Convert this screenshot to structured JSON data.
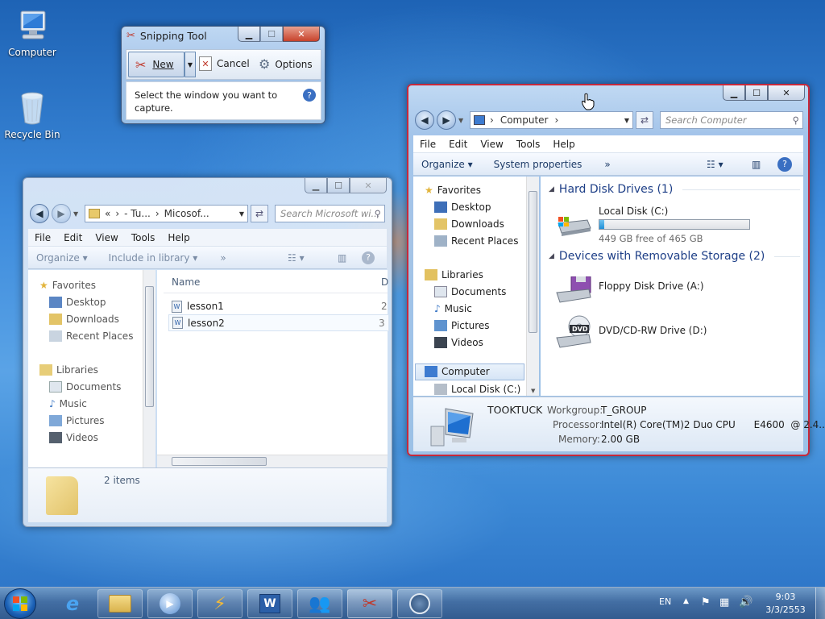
{
  "desktop": {
    "icons": [
      {
        "label": "Computer"
      },
      {
        "label": "Recycle Bin"
      }
    ]
  },
  "snipping": {
    "title": "Snipping Tool",
    "new_label": "New",
    "cancel_label": "Cancel",
    "options_label": "Options",
    "message": "Select the window you want to capture."
  },
  "explorer_back": {
    "address": {
      "prefix": "«",
      "crumb1": "- Tu...",
      "crumb2": "Micosof..."
    },
    "search_placeholder": "Search Microsoft wi...",
    "menu": [
      "File",
      "Edit",
      "View",
      "Tools",
      "Help"
    ],
    "commands": {
      "organize": "Organize",
      "include": "Include in library",
      "more": "»"
    },
    "nav": {
      "favorites": "Favorites",
      "favorites_items": [
        "Desktop",
        "Downloads",
        "Recent Places"
      ],
      "libraries": "Libraries",
      "library_items": [
        "Documents",
        "Music",
        "Pictures",
        "Videos"
      ]
    },
    "columns": {
      "name": "Name",
      "date": "D"
    },
    "files": [
      {
        "name": "lesson1",
        "tail": "2"
      },
      {
        "name": "lesson2",
        "tail": "3"
      }
    ],
    "status": "2 items"
  },
  "computer": {
    "address": {
      "crumb": "Computer"
    },
    "search_placeholder": "Search Computer",
    "menu": [
      "File",
      "Edit",
      "View",
      "Tools",
      "Help"
    ],
    "commands": {
      "organize": "Organize",
      "system": "System properties",
      "more": "»"
    },
    "nav": {
      "favorites": "Favorites",
      "favorites_items": [
        "Desktop",
        "Downloads",
        "Recent Places"
      ],
      "libraries": "Libraries",
      "library_items": [
        "Documents",
        "Music",
        "Pictures",
        "Videos"
      ],
      "computer": "Computer",
      "local_disk": "Local Disk (C:)"
    },
    "groups": {
      "hdd": "Hard Disk Drives (1)",
      "removable": "Devices with Removable Storage (2)"
    },
    "drives": {
      "c_label": "Local Disk (C:)",
      "c_free": "449 GB free of 465 GB",
      "c_used_fraction": 0.034,
      "a_label": "Floppy Disk Drive (A:)",
      "d_label": "DVD/CD-RW Drive (D:)",
      "dvd_badge": "DVD"
    },
    "details": {
      "name": "TOOKTUCK",
      "workgroup_label": "Workgroup:",
      "workgroup": "T_GROUP",
      "processor_label": "Processor:",
      "processor": "Intel(R) Core(TM)2 Duo CPU      E4600  @ 2.4...",
      "memory_label": "Memory:",
      "memory": "2.00 GB"
    }
  },
  "taskbar": {
    "lang": "EN",
    "time": "9:03",
    "date": "3/3/2553"
  },
  "colors": {
    "accent": "#1e5fb4",
    "close": "#c7422b",
    "drive_bar": "#2a9de0"
  }
}
